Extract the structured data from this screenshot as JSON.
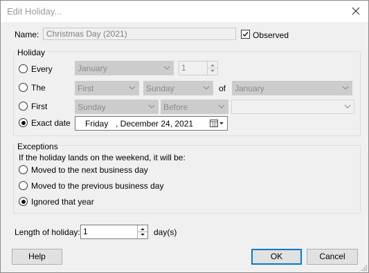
{
  "window": {
    "title": "Edit Holiday..."
  },
  "name_row": {
    "label": "Name:",
    "value": "Christmas Day (2021)",
    "observed_label": "Observed",
    "observed_checked": true
  },
  "holiday": {
    "group_title": "Holiday",
    "every": {
      "label": "Every",
      "month": "January",
      "day": "1"
    },
    "the": {
      "label": "The",
      "ordinal": "First",
      "weekday": "Sunday",
      "of_label": "of",
      "month": "January"
    },
    "first": {
      "label": "First",
      "weekday": "Sunday",
      "relation": "Before",
      "target": ""
    },
    "exact": {
      "label": "Exact date",
      "day_of_week": "Friday",
      "date": ", December 24, 2021"
    },
    "selected": "exact"
  },
  "exceptions": {
    "group_title": "Exceptions",
    "prompt": "If the holiday lands on the weekend, it will be:",
    "options": [
      "Moved to the next business day",
      "Moved to the previous business day",
      "Ignored that year"
    ],
    "selected_index": 2
  },
  "length": {
    "label": "Length of holiday:",
    "value": "1",
    "unit": "day(s)"
  },
  "buttons": {
    "help": "Help",
    "ok": "OK",
    "cancel": "Cancel"
  },
  "icons": {
    "close": "close-icon",
    "calendar": "calendar-icon",
    "dropdown": "chevron-down-icon"
  },
  "colors": {
    "accent": "#0078d7",
    "disabled_text": "#8a8a8a",
    "dialog_bg": "#f0f0f0"
  }
}
